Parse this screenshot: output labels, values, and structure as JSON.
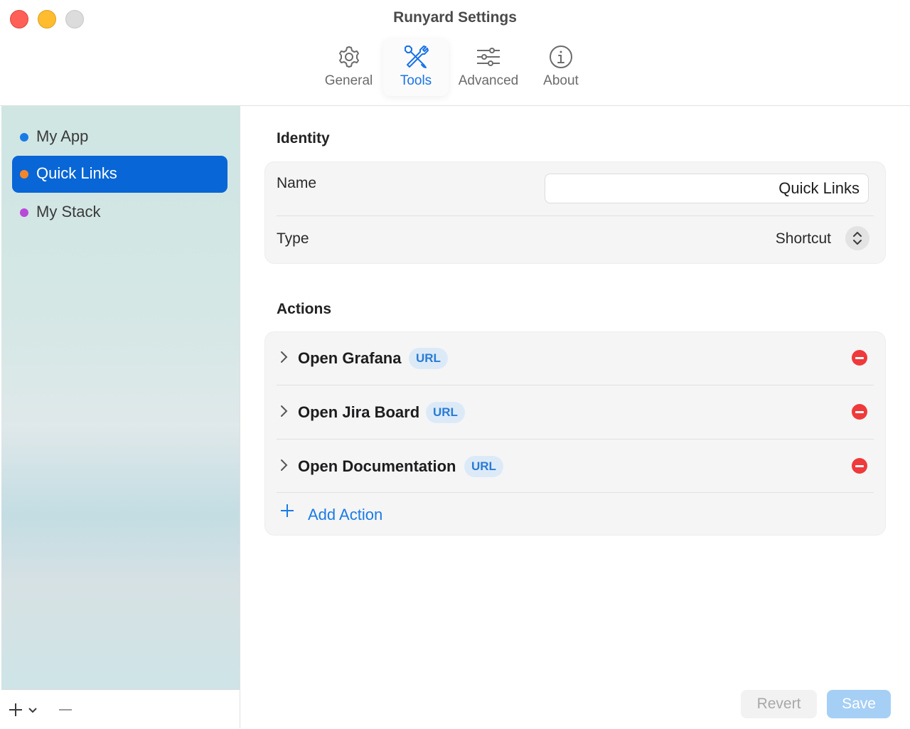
{
  "window": {
    "title": "Runyard Settings"
  },
  "tabs": [
    {
      "label": "General",
      "icon": "gear-icon"
    },
    {
      "label": "Tools",
      "icon": "wrench-screwdriver-icon",
      "active": true
    },
    {
      "label": "Advanced",
      "icon": "sliders-icon"
    },
    {
      "label": "About",
      "icon": "info-icon"
    }
  ],
  "sidebar": {
    "items": [
      {
        "label": "My App",
        "dot_color": "#1a7be6"
      },
      {
        "label": "Quick Links",
        "dot_color": "#f5862c",
        "selected": true
      },
      {
        "label": "My Stack",
        "dot_color": "#b84ad8"
      }
    ],
    "footer": {
      "add_symbol": "+",
      "remove_symbol": "—"
    }
  },
  "identity": {
    "section_title": "Identity",
    "name_label": "Name",
    "name_value": "Quick Links",
    "type_label": "Type",
    "type_value": "Shortcut"
  },
  "actions": {
    "section_title": "Actions",
    "items": [
      {
        "name": "Open Grafana",
        "badge": "URL"
      },
      {
        "name": "Open Jira Board",
        "badge": "URL"
      },
      {
        "name": "Open Documentation",
        "badge": "URL"
      }
    ],
    "add_label": "Add Action"
  },
  "footer_buttons": {
    "revert_label": "Revert",
    "save_label": "Save"
  },
  "colors": {
    "accent": "#1a7be6",
    "selection": "#0866d6",
    "destructive": "#f0393a"
  }
}
